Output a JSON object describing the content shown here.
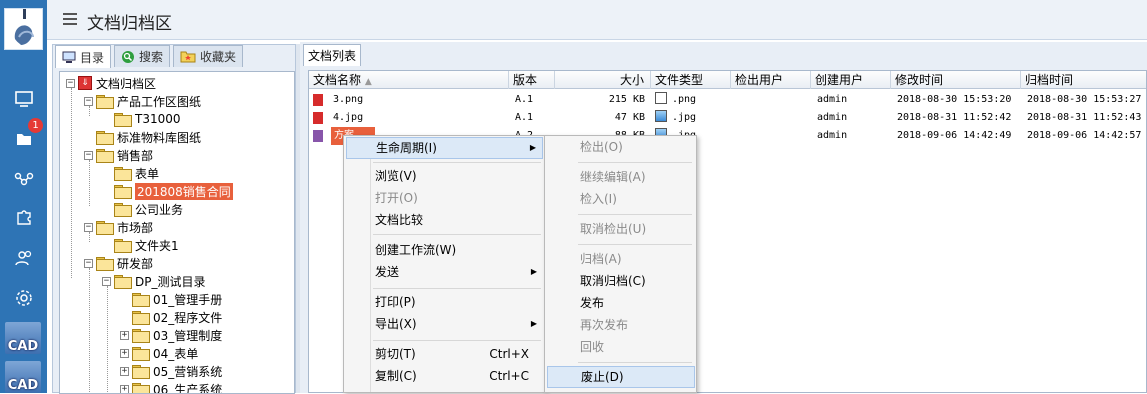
{
  "app": {
    "title": "文档归档区"
  },
  "sidebar": {
    "badge": "1",
    "cad_label_1": "CAD",
    "cad_label_2": "CAD"
  },
  "left_tabs": [
    {
      "label": "目录",
      "active": true
    },
    {
      "label": "搜索",
      "active": false
    },
    {
      "label": "收藏夹",
      "active": false
    }
  ],
  "tree": {
    "root": "文档归档区",
    "n1": "产品工作区图纸",
    "n1a": "T31000",
    "n2": "标准物料库图纸",
    "n3": "销售部",
    "n3a": "表单",
    "n3b": "201808销售合同",
    "n3c": "公司业务",
    "n4": "市场部",
    "n4a": "文件夹1",
    "n5": "研发部",
    "n5a": "DP_测试目录",
    "n5a1": "01_管理手册",
    "n5a2": "02_程序文件",
    "n5a3": "03_管理制度",
    "n5a4": "04_表单",
    "n5a5": "05_营销系统",
    "n5a6": "06_生产系统"
  },
  "doc_tab": "文档列表",
  "columns": [
    "文档名称",
    "版本",
    "大小",
    "文件类型",
    "检出用户",
    "创建用户",
    "修改时间",
    "归档时间"
  ],
  "rows": [
    {
      "name": "3.png",
      "version": "A.1",
      "size": "215 KB",
      "type": ".png",
      "checkout": "",
      "creator": "admin",
      "modified": "2018-08-30 15:53:20",
      "archived": "2018-08-30 15:53:27"
    },
    {
      "name": "4.jpg",
      "version": "A.1",
      "size": "47 KB",
      "type": ".jpg",
      "checkout": "",
      "creator": "admin",
      "modified": "2018-08-31 11:52:42",
      "archived": "2018-08-31 11:52:43"
    },
    {
      "name": "方案...",
      "version": "A.2",
      "size": "88 KB",
      "type": ".jpg",
      "checkout": "",
      "creator": "admin",
      "modified": "2018-09-06 14:42:49",
      "archived": "2018-09-06 14:42:57"
    }
  ],
  "context_menu": {
    "lifecycle": "生命周期(I)",
    "browse": "浏览(V)",
    "open": "打开(O)",
    "compare": "文档比较",
    "workflow": "创建工作流(W)",
    "send": "发送",
    "print": "打印(P)",
    "export": "导出(X)",
    "cut": "剪切(T)",
    "cut_sc": "Ctrl+X",
    "copy": "复制(C)",
    "copy_sc": "Ctrl+C"
  },
  "submenu": {
    "checkout": "检出(O)",
    "continue_edit": "继续编辑(A)",
    "checkin": "检入(I)",
    "cancel_checkout": "取消检出(U)",
    "archive": "归档(A)",
    "cancel_archive": "取消归档(C)",
    "publish": "发布",
    "republish": "再次发布",
    "recall": "回收",
    "obsolete": "废止(D)"
  }
}
